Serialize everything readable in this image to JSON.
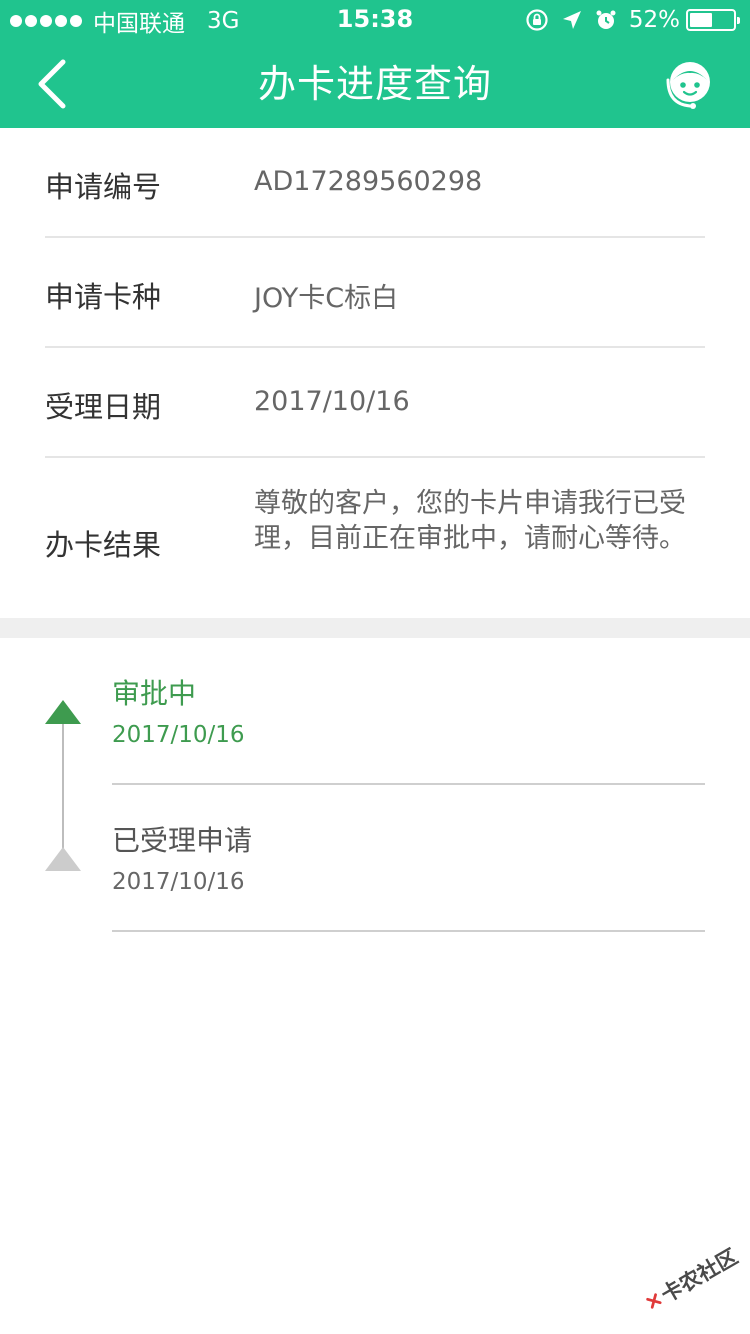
{
  "status_bar": {
    "carrier": "中国联通",
    "network": "3G",
    "time": "15:38",
    "battery_text": "52%",
    "battery_level": 0.52
  },
  "nav": {
    "title": "办卡进度查询",
    "back_icon": "chevron-left-icon",
    "service_icon": "customer-service-icon"
  },
  "info": {
    "rows": [
      {
        "label": "申请编号",
        "value": "AD17289560298"
      },
      {
        "label": "申请卡种",
        "value": "JOY卡C标白"
      },
      {
        "label": "受理日期",
        "value": "2017/10/16"
      },
      {
        "label": "办卡结果",
        "value": "尊敬的客户，您的卡片申请我行已受理，目前正在审批中，请耐心等待。"
      }
    ]
  },
  "timeline": {
    "items": [
      {
        "status": "审批中",
        "date": "2017/10/16",
        "state": "active"
      },
      {
        "status": "已受理申请",
        "date": "2017/10/16",
        "state": "inactive"
      }
    ]
  },
  "watermark": {
    "text": "卡农社区"
  },
  "colors": {
    "brand_green": "#20c48e",
    "active_green": "#3e9b4f",
    "inactive_gray": "#cccccc"
  }
}
